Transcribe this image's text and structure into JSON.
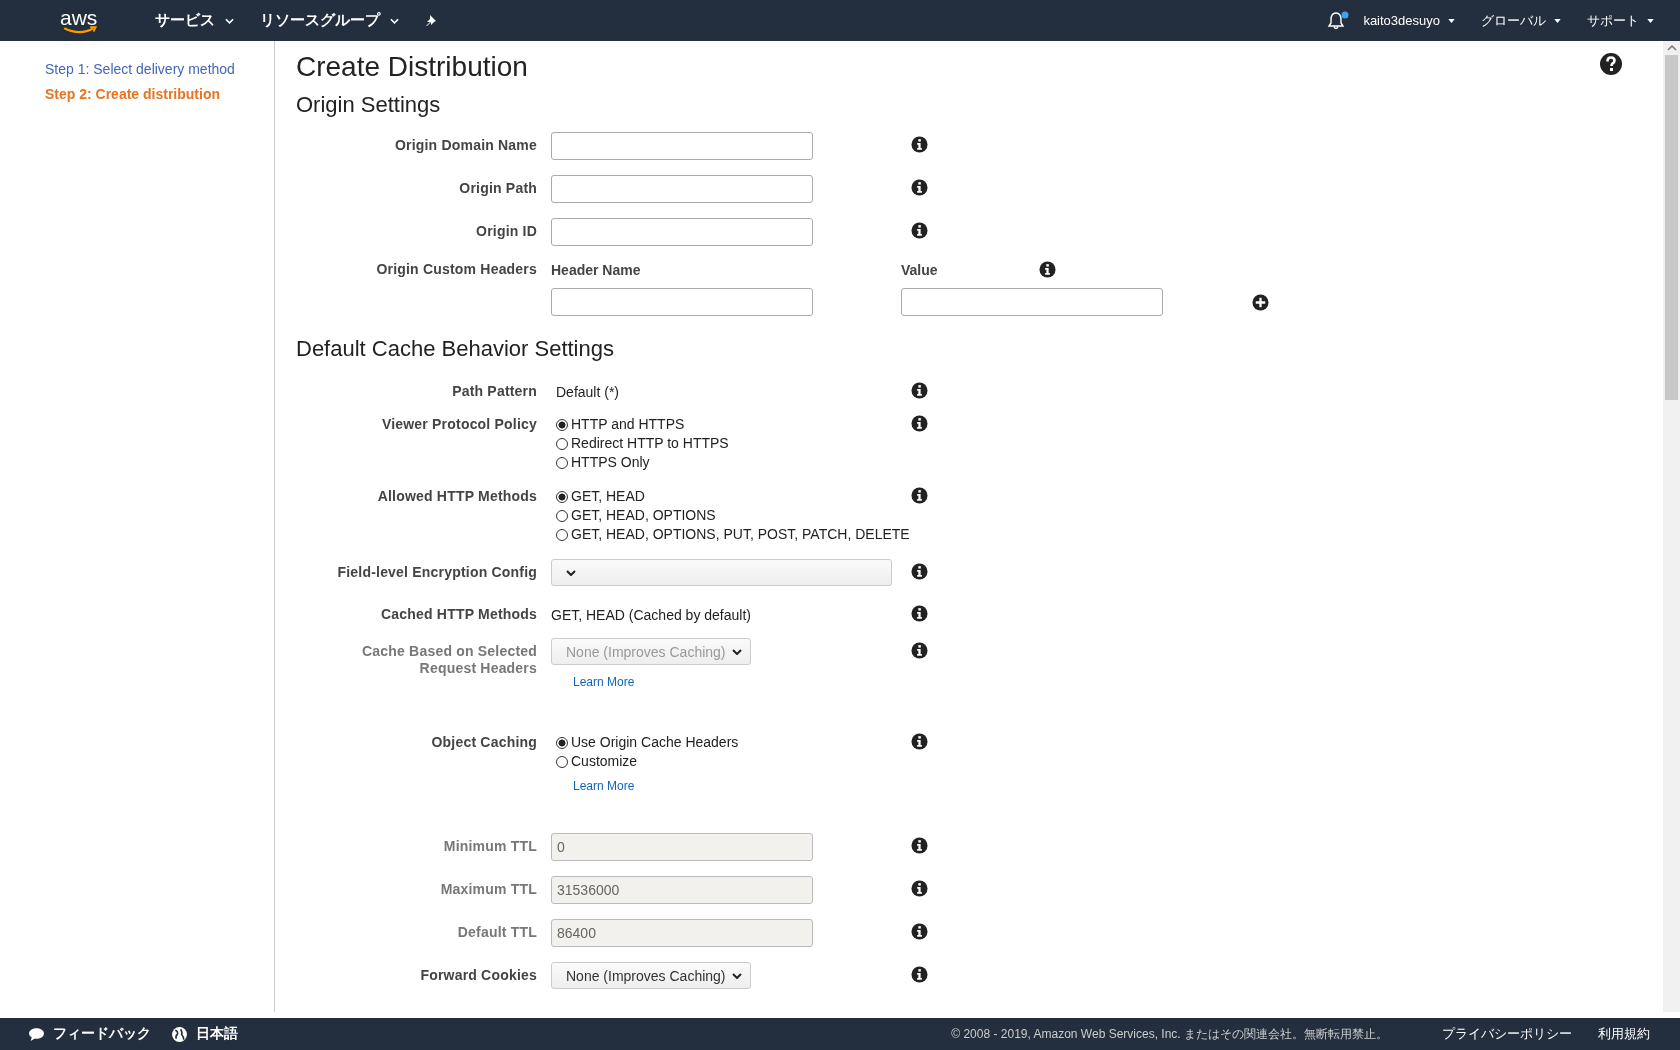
{
  "top_bar": {
    "logo": "aws",
    "nav": [
      {
        "label": "サービス"
      },
      {
        "label": "リソースグループ"
      }
    ],
    "user_menus": [
      {
        "label": "kaito3desuyo"
      },
      {
        "label": "グローバル"
      },
      {
        "label": "サポート"
      }
    ],
    "notification_unread": true
  },
  "sidebar": {
    "steps": [
      {
        "label": "Step 1: Select delivery method",
        "selected": false
      },
      {
        "label": "Step 2: Create distribution",
        "selected": true
      }
    ]
  },
  "page_title": "Create Distribution",
  "sections": [
    {
      "title": "Origin Settings",
      "rows": [
        {
          "kind": "input",
          "label": "Origin Domain Name",
          "value": "",
          "disabled": false
        },
        {
          "kind": "input",
          "label": "Origin Path",
          "value": "",
          "disabled": false
        },
        {
          "kind": "input",
          "label": "Origin ID",
          "value": "",
          "disabled": false
        },
        {
          "kind": "headers",
          "label": "Origin Custom Headers",
          "name_heading": "Header Name",
          "value_heading": "Value"
        }
      ]
    },
    {
      "title": "Default Cache Behavior Settings",
      "rows": [
        {
          "kind": "text",
          "label": "Path Pattern",
          "text": "Default (*)"
        },
        {
          "kind": "radio",
          "label": "Viewer Protocol Policy",
          "options": [
            {
              "label": "HTTP and HTTPS",
              "selected": true
            },
            {
              "label": "Redirect HTTP to HTTPS",
              "selected": false
            },
            {
              "label": "HTTPS Only",
              "selected": false
            }
          ]
        },
        {
          "kind": "radio",
          "label": "Allowed HTTP Methods",
          "options": [
            {
              "label": "GET, HEAD",
              "selected": true
            },
            {
              "label": "GET, HEAD, OPTIONS",
              "selected": false
            },
            {
              "label": "GET, HEAD, OPTIONS, PUT, POST, PATCH, DELETE",
              "selected": false
            }
          ]
        },
        {
          "kind": "select",
          "label": "Field-level Encryption Config",
          "value": "",
          "disabled": false,
          "wide": true
        },
        {
          "kind": "text",
          "label": "Cached HTTP Methods",
          "text": "GET, HEAD (Cached by default)"
        },
        {
          "kind": "select",
          "label": "Cache Based on Selected Request Headers",
          "value": "None (Improves Caching)",
          "disabled": true,
          "wide": false,
          "link": "Learn More"
        },
        {
          "kind": "radio",
          "label": "Object Caching",
          "options": [
            {
              "label": "Use Origin Cache Headers",
              "selected": true
            },
            {
              "label": "Customize",
              "selected": false
            }
          ],
          "link": "Learn More"
        },
        {
          "kind": "input",
          "label": "Minimum TTL",
          "value": "0",
          "disabled": true
        },
        {
          "kind": "input",
          "label": "Maximum TTL",
          "value": "31536000",
          "disabled": true
        },
        {
          "kind": "input",
          "label": "Default TTL",
          "value": "86400",
          "disabled": true
        },
        {
          "kind": "select",
          "label": "Forward Cookies",
          "value": "None (Improves Caching)",
          "disabled": false,
          "wide": false
        }
      ]
    }
  ],
  "footer": {
    "feedback": "フィードバック",
    "language": "日本語",
    "copyright": "© 2008 - 2019, Amazon Web Services, Inc. またはその関連会社。無断転用禁止。",
    "links": [
      {
        "label": "プライバシーポリシー"
      },
      {
        "label": "利用規約"
      }
    ]
  }
}
